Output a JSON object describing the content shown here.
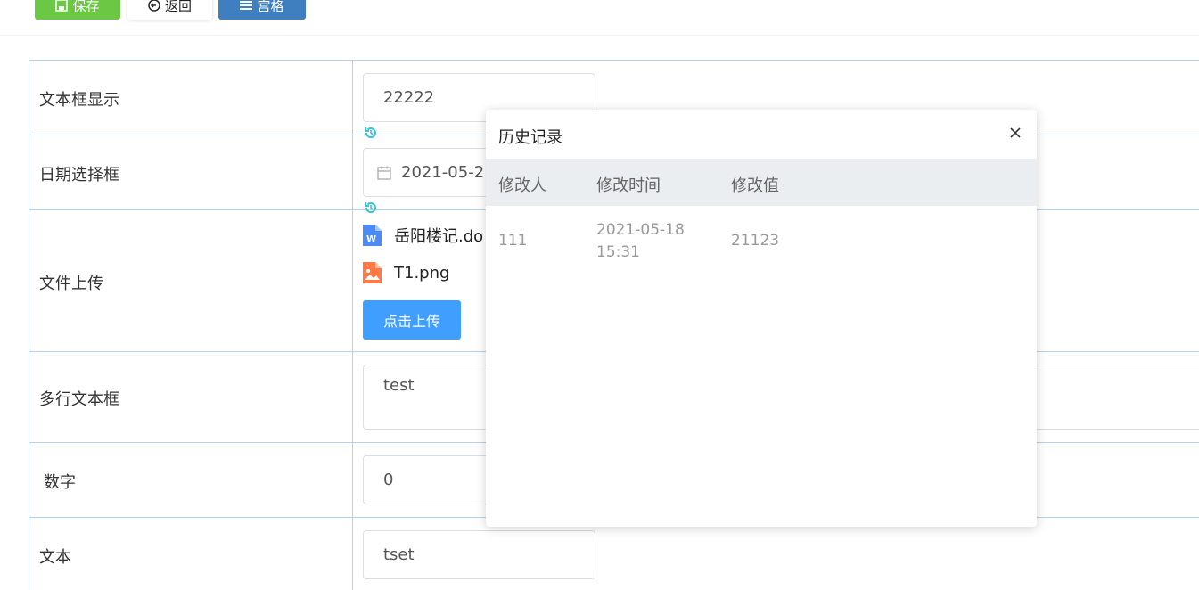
{
  "toolbar": {
    "save_label": "保存",
    "back_label": "返回",
    "grid_label": "宫格"
  },
  "form": {
    "rows": [
      {
        "label": "文本框显示",
        "value": "22222"
      },
      {
        "label": "日期选择框",
        "value": "2021-05-2"
      },
      {
        "label": "文件上传"
      },
      {
        "label": "多行文本框",
        "value": "test"
      },
      {
        "label": "数字",
        "value": "0"
      },
      {
        "label": "文本",
        "value": "tset"
      }
    ],
    "files": [
      {
        "name": "岳阳楼记.do",
        "icon": "word-file-icon"
      },
      {
        "name": "T1.png",
        "icon": "image-file-icon"
      }
    ],
    "upload_label": "点击上传"
  },
  "history_popup": {
    "title": "历史记录",
    "columns": [
      "修改人",
      "修改时间",
      "修改值"
    ],
    "rows": [
      {
        "user": "111",
        "time_date": "2021-05-18",
        "time_clock": "15:31",
        "value": "21123"
      }
    ]
  },
  "colors": {
    "save": "#6cc744",
    "grid": "#3f7fbf",
    "upload": "#409eff",
    "history_icon": "#35c3d6",
    "table_border": "#b7d2e8"
  }
}
